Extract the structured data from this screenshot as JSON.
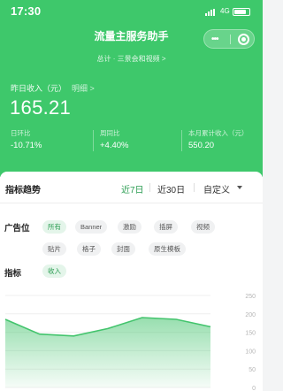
{
  "status_bar": {
    "time": "17:30",
    "network": "4G"
  },
  "nav": {
    "title": "流量主服务助手",
    "subtitle": "总计 · 三景会和视频 >"
  },
  "income": {
    "label": "昨日收入（元）",
    "tag": "明细 >",
    "value": "165.21",
    "stats": [
      {
        "label": "日环比",
        "value": "-10.71%"
      },
      {
        "label": "周同比",
        "value": "+4.40%"
      },
      {
        "label": "本月累计收入（元）",
        "value": "550.20"
      }
    ]
  },
  "trend": {
    "title": "指标趋势",
    "ranges": [
      "近7日",
      "近30日",
      "自定义"
    ],
    "active_range": "近7日"
  },
  "ad_position": {
    "label": "广告位",
    "chips": [
      "所有",
      "Banner",
      "激励",
      "插屏",
      "视频",
      "贴片",
      "格子",
      "封面",
      "原生模板"
    ],
    "active": "所有"
  },
  "metric": {
    "label": "指标",
    "chips": [
      "收入"
    ],
    "active": "收入"
  },
  "chart_data": {
    "type": "area",
    "title": "",
    "xlabel": "",
    "ylabel": "",
    "x": [
      "1",
      "2",
      "3",
      "4",
      "5",
      "6",
      "7"
    ],
    "series": [
      {
        "values": [
          185,
          145,
          140,
          160,
          190,
          185,
          165
        ]
      }
    ],
    "ylim": [
      0,
      250
    ],
    "y_ticks": [
      "250",
      "200",
      "150",
      "100",
      "50",
      "0"
    ],
    "grid": true,
    "color": "#43c46d"
  }
}
